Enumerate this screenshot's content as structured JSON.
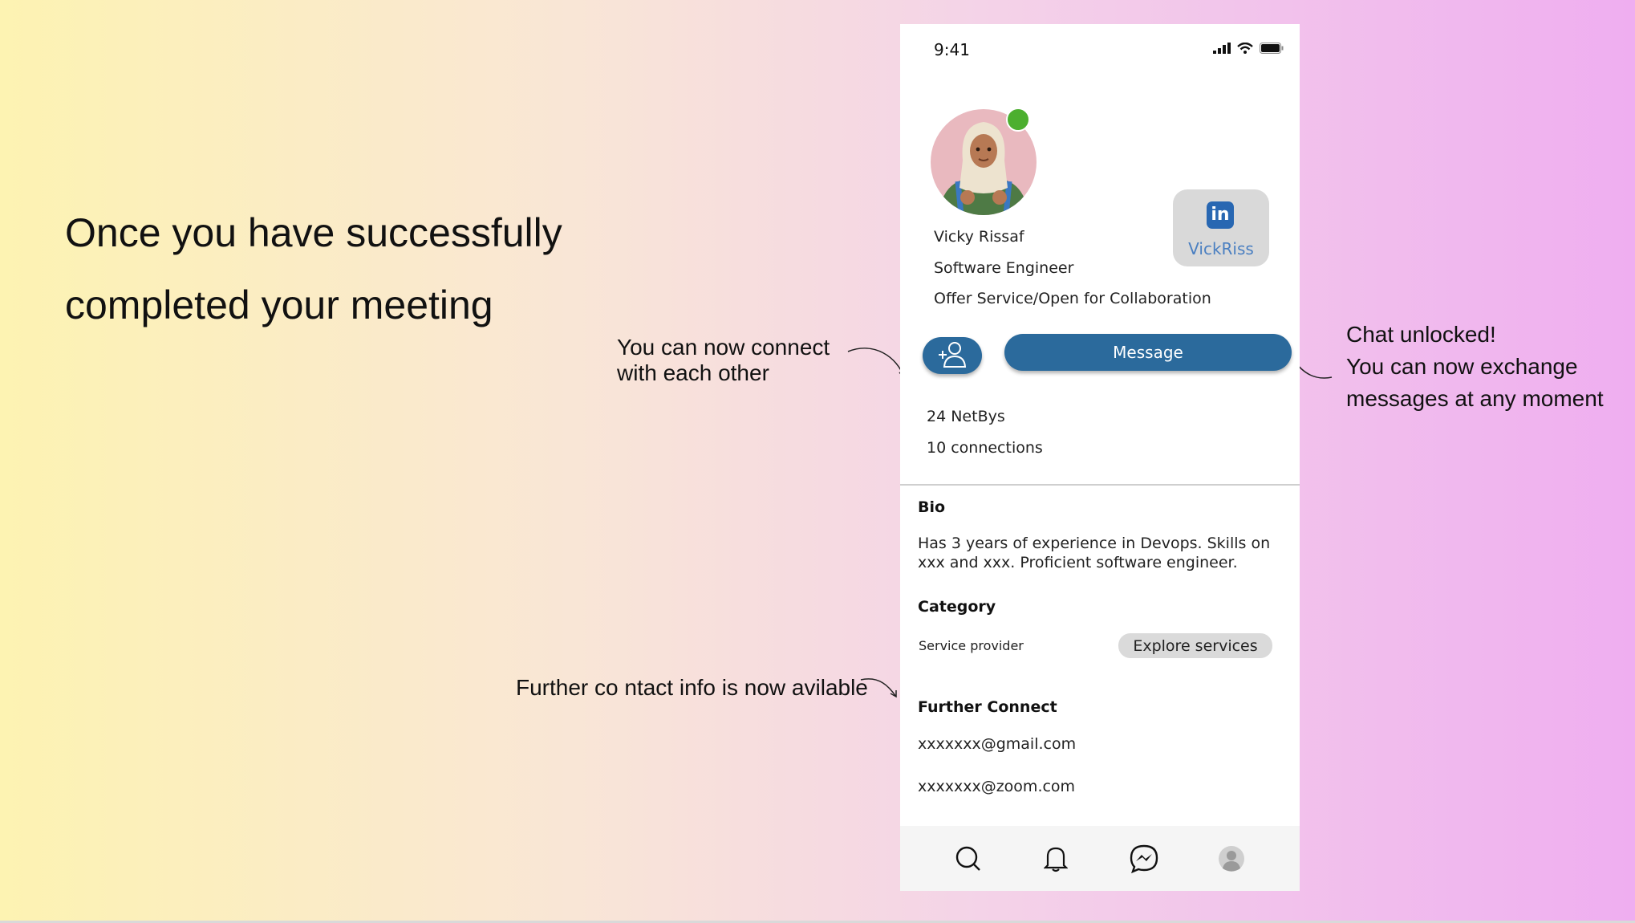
{
  "slide": {
    "headline": "Once you have successfully completed your meeting",
    "annotations": {
      "connect": "You can now connect with each other",
      "chat_line1": "Chat unlocked!",
      "chat_line2": "You can now exchange messages at any moment",
      "contact": "Further co ntact info is now avilable"
    },
    "background_colors": [
      "#fdf3b2",
      "#efaef0"
    ]
  },
  "phone": {
    "status_bar": {
      "time": "9:41",
      "icons": [
        "signal-icon",
        "wifi-icon",
        "battery-icon"
      ]
    },
    "profile": {
      "name": "Vicky Rissaf",
      "role": "Software Engineer",
      "offer": "Offer Service/Open for Collaboration",
      "online": true,
      "online_color": "#4caf2f"
    },
    "linkedin": {
      "logo": "in",
      "handle": "VickRiss"
    },
    "actions": {
      "connect_icon": "add-person-icon",
      "message_label": "Message",
      "accent": "#2b6a9c"
    },
    "stats": {
      "netbys": "24 NetBys",
      "connections": "10 connections"
    },
    "bio": {
      "title": "Bio",
      "text": "Has 3 years of experience in Devops. Skills on xxx and xxx. Proficient software engineer."
    },
    "category": {
      "title": "Category",
      "value": "Service provider",
      "explore_label": "Explore services"
    },
    "further_connect": {
      "title": "Further Connect",
      "email_gmail": "xxxxxxx@gmail.com",
      "email_zoom": "xxxxxxx@zoom.com"
    },
    "tabbar": [
      "search-icon",
      "bell-icon",
      "messenger-icon",
      "profile-icon"
    ]
  }
}
